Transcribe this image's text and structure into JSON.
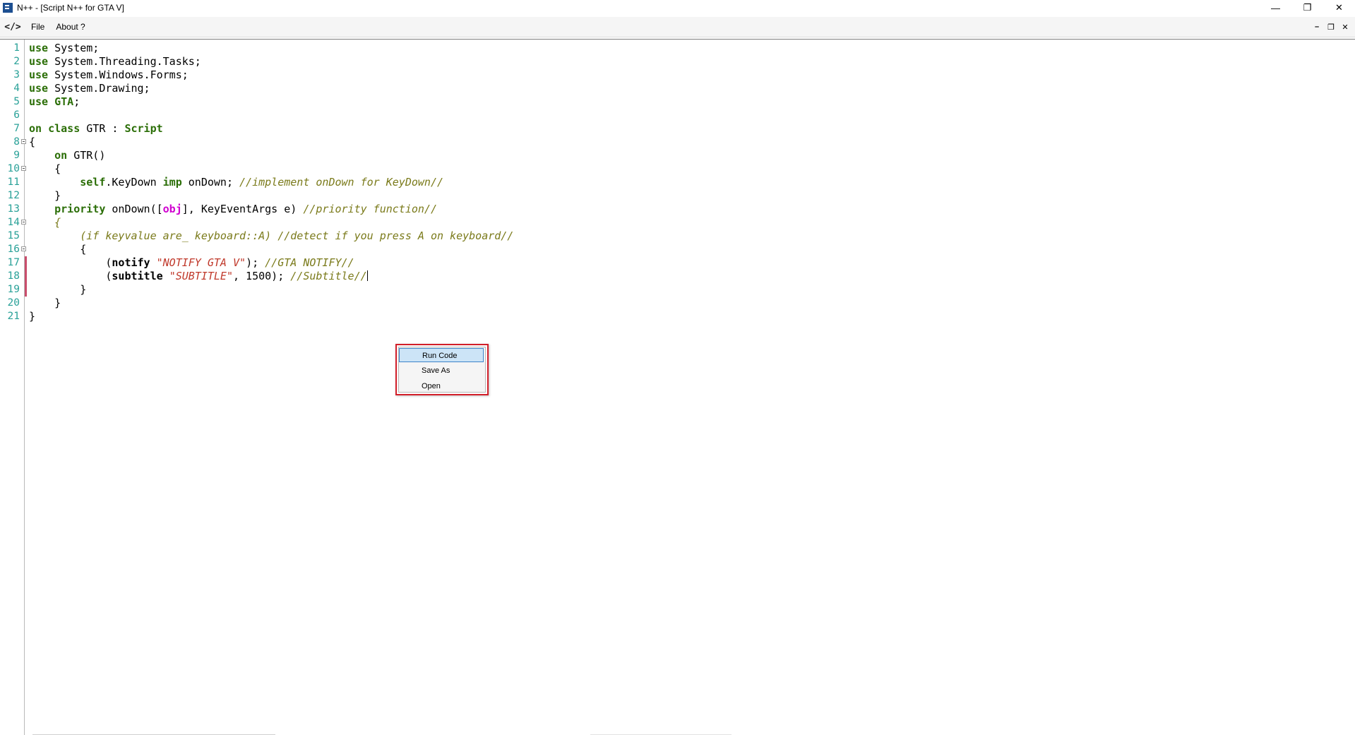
{
  "window": {
    "title": "N++ - [Script N++ for GTA V]",
    "controls": {
      "minimize": "—",
      "restore": "❐",
      "close": "✕"
    }
  },
  "menubar": {
    "icon_glyph": "</>",
    "items": [
      {
        "label": "File"
      },
      {
        "label": "About ?"
      }
    ],
    "mdi_controls": {
      "minimize": "–",
      "restore": "❐",
      "close": "✕"
    }
  },
  "editor": {
    "line_numbers": [
      "1",
      "2",
      "3",
      "4",
      "5",
      "6",
      "7",
      "8",
      "9",
      "10",
      "11",
      "12",
      "13",
      "14",
      "15",
      "16",
      "17",
      "18",
      "19",
      "20",
      "21"
    ],
    "lines": [
      [
        {
          "t": "use",
          "c": "kw"
        },
        {
          "t": " System;",
          "c": "plain"
        }
      ],
      [
        {
          "t": "use",
          "c": "kw"
        },
        {
          "t": " System.Threading.Tasks;",
          "c": "plain"
        }
      ],
      [
        {
          "t": "use",
          "c": "kw"
        },
        {
          "t": " System.Windows.Forms;",
          "c": "plain"
        }
      ],
      [
        {
          "t": "use",
          "c": "kw"
        },
        {
          "t": " System.Drawing;",
          "c": "plain"
        }
      ],
      [
        {
          "t": "use",
          "c": "kw"
        },
        {
          "t": " ",
          "c": "plain"
        },
        {
          "t": "GTA",
          "c": "type"
        },
        {
          "t": ";",
          "c": "plain"
        }
      ],
      [],
      [
        {
          "t": "on class",
          "c": "kw"
        },
        {
          "t": " GTR : ",
          "c": "plain"
        },
        {
          "t": "Script",
          "c": "type"
        }
      ],
      [
        {
          "t": "{",
          "c": "plain"
        }
      ],
      [
        {
          "t": "    ",
          "c": "plain"
        },
        {
          "t": "on",
          "c": "kw"
        },
        {
          "t": " GTR()",
          "c": "plain"
        }
      ],
      [
        {
          "t": "    {",
          "c": "plain"
        }
      ],
      [
        {
          "t": "        ",
          "c": "plain"
        },
        {
          "t": "self",
          "c": "kw"
        },
        {
          "t": ".KeyDown ",
          "c": "plain"
        },
        {
          "t": "imp",
          "c": "kw"
        },
        {
          "t": " onDown; ",
          "c": "plain"
        },
        {
          "t": "//implement onDown for KeyDown//",
          "c": "comment"
        }
      ],
      [
        {
          "t": "    }",
          "c": "plain"
        }
      ],
      [
        {
          "t": "    ",
          "c": "plain"
        },
        {
          "t": "priority",
          "c": "kw"
        },
        {
          "t": " onDown([",
          "c": "plain"
        },
        {
          "t": "obj",
          "c": "magenta"
        },
        {
          "t": "], KeyEventArgs e) ",
          "c": "plain"
        },
        {
          "t": "//priority function//",
          "c": "comment"
        }
      ],
      [
        {
          "t": "    {",
          "c": "comment"
        }
      ],
      [
        {
          "t": "        ",
          "c": "plain"
        },
        {
          "t": "(if keyvalue are_ keyboard::A) //detect if you press A on keyboard//",
          "c": "comment"
        }
      ],
      [
        {
          "t": "        {",
          "c": "plain"
        }
      ],
      [
        {
          "t": "            (",
          "c": "plain"
        },
        {
          "t": "notify",
          "c": "fn"
        },
        {
          "t": " ",
          "c": "plain"
        },
        {
          "t": "\"NOTIFY GTA V\"",
          "c": "str"
        },
        {
          "t": "); ",
          "c": "plain"
        },
        {
          "t": "//GTA NOTIFY//",
          "c": "comment"
        }
      ],
      [
        {
          "t": "            (",
          "c": "plain"
        },
        {
          "t": "subtitle",
          "c": "fn"
        },
        {
          "t": " ",
          "c": "plain"
        },
        {
          "t": "\"SUBTITLE\"",
          "c": "str"
        },
        {
          "t": ", 1500); ",
          "c": "plain"
        },
        {
          "t": "//Subtitle//",
          "c": "comment"
        }
      ],
      [
        {
          "t": "        }",
          "c": "plain"
        }
      ],
      [
        {
          "t": "    }",
          "c": "plain"
        }
      ],
      [
        {
          "t": "}",
          "c": "plain"
        }
      ]
    ],
    "fold_lines": [
      8,
      10,
      14,
      16
    ],
    "changed_lines": [
      17,
      18,
      19
    ],
    "caret_line": 18
  },
  "context_menu": {
    "items": [
      {
        "label": "Run Code",
        "highlighted": true
      },
      {
        "label": "Save As",
        "highlighted": false
      },
      {
        "label": "Open",
        "highlighted": false
      }
    ],
    "border_color": "#d21f2a"
  }
}
